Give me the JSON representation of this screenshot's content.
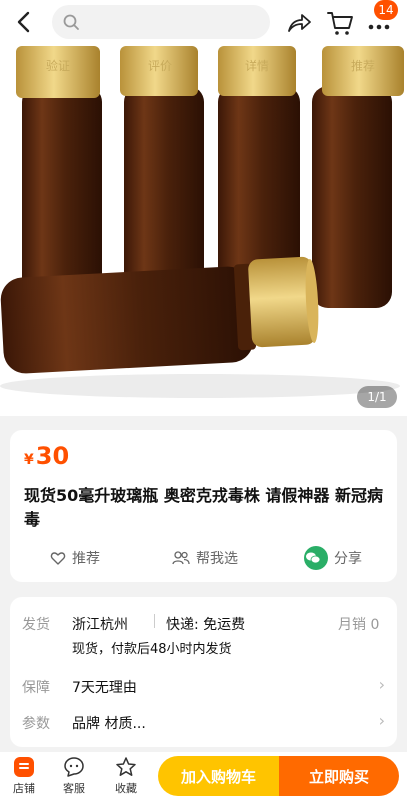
{
  "header": {
    "search_placeholder": "",
    "cart_badge": "14"
  },
  "gallery": {
    "counter": "1/1",
    "cap_texts": [
      "验证",
      "评价",
      "详情",
      "推荐"
    ]
  },
  "product": {
    "currency": "¥",
    "price": "30",
    "title": "现货50毫升玻璃瓶 奥密克戎毒株 请假神器 新冠病毒",
    "actions": {
      "recommend": "推荐",
      "help_choose": "帮我选",
      "share": "分享"
    }
  },
  "info": {
    "ship_label": "发货",
    "ship_from": "浙江杭州",
    "express": "快递: 免运费",
    "monthly_sales": "月销 0",
    "ship_note": "现货，付款后48小时内发货",
    "guarantee_label": "保障",
    "guarantee_value": "7天无理由",
    "params_label": "参数",
    "params_value": "品牌 材质..."
  },
  "bottom": {
    "store": "店铺",
    "service": "客服",
    "favorite": "收藏",
    "add_to_cart": "加入购物车",
    "buy_now": "立即购买"
  },
  "colors": {
    "accent": "#ff5000",
    "cart_btn": "#ffc400",
    "buy_btn": "#ff6a00",
    "bottle": "#5b2c12",
    "cap": "#d9b45a"
  }
}
